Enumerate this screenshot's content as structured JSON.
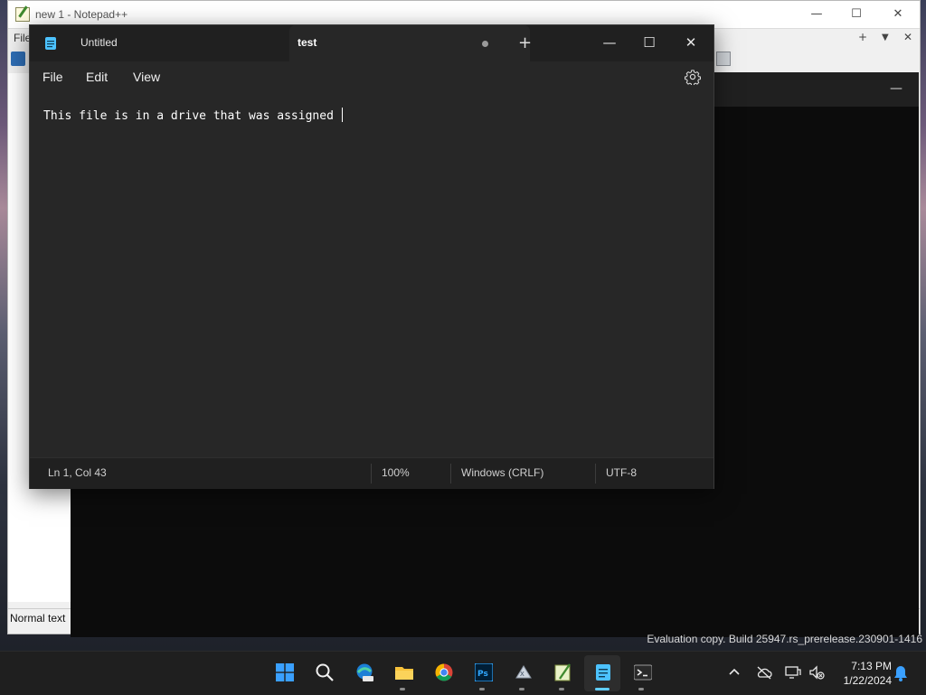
{
  "npp": {
    "title": "new 1 - Notepad++",
    "menu_file": "File",
    "status_text": "Normal text fi"
  },
  "notepad": {
    "tabs": [
      {
        "label": "Untitled"
      },
      {
        "label": "test"
      }
    ],
    "new_tab": "+",
    "menu": {
      "file": "File",
      "edit": "Edit",
      "view": "View"
    },
    "content": "This file is in a drive that was assigned ",
    "status": {
      "position": "Ln 1, Col 43",
      "zoom": "100%",
      "line_ending": "Windows (CRLF)",
      "encoding": "UTF-8"
    }
  },
  "watermark": "Evaluation copy. Build 25947.rs_prerelease.230901-1416",
  "taskbar": {
    "apps": [
      "start-icon",
      "search-icon",
      "edge-pre-icon",
      "file-explorer-icon",
      "chrome-icon",
      "photoshop-icon",
      "xml-tool-icon",
      "notepad-plus-plus-icon",
      "notepad-icon",
      "terminal-icon"
    ],
    "clock": {
      "time": "7:13 PM",
      "date": "1/22/2024"
    }
  },
  "colors": {
    "accent": "#60cdff",
    "dark_bg": "#272727",
    "titlebar": "#202020"
  }
}
